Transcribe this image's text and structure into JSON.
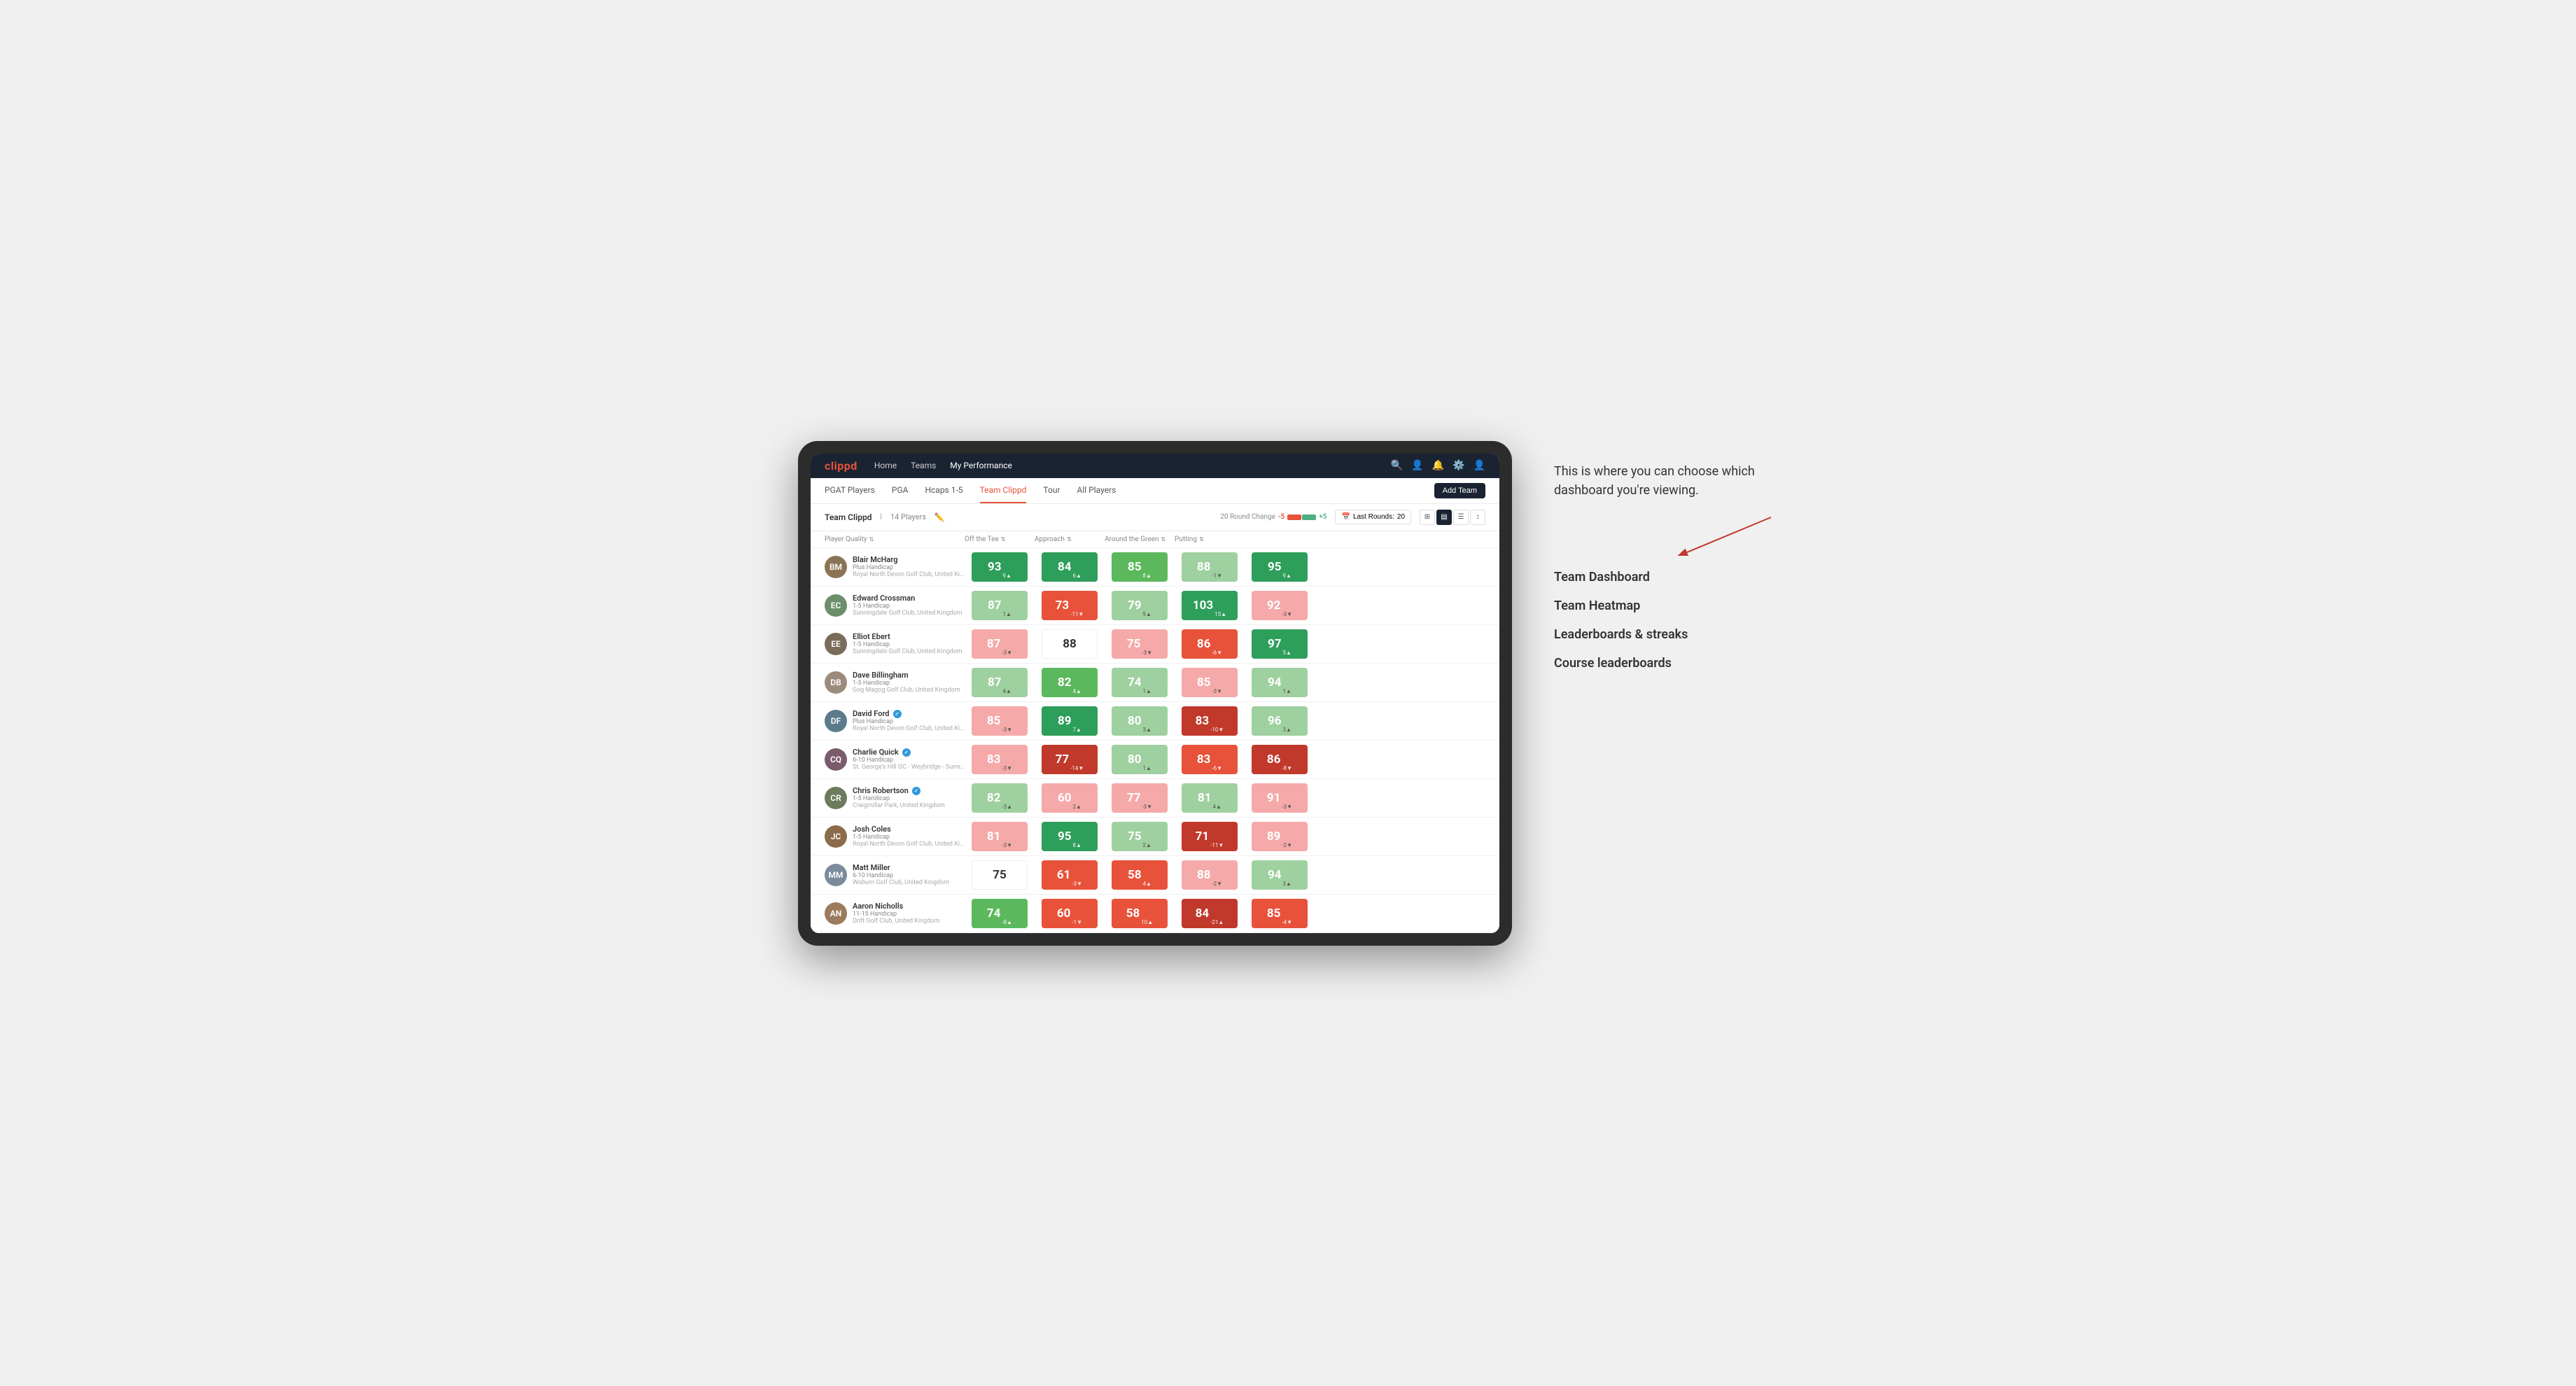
{
  "annotation": {
    "intro_text": "This is where you can choose which dashboard you're viewing.",
    "items": [
      {
        "id": "team-dashboard",
        "label": "Team Dashboard"
      },
      {
        "id": "team-heatmap",
        "label": "Team Heatmap"
      },
      {
        "id": "leaderboards",
        "label": "Leaderboards & streaks"
      },
      {
        "id": "course-leaderboards",
        "label": "Course leaderboards"
      }
    ]
  },
  "top_nav": {
    "logo": "clippd",
    "links": [
      {
        "label": "Home",
        "active": false
      },
      {
        "label": "Teams",
        "active": false
      },
      {
        "label": "My Performance",
        "active": true
      }
    ]
  },
  "sub_nav": {
    "links": [
      {
        "label": "PGAT Players",
        "active": false
      },
      {
        "label": "PGA",
        "active": false
      },
      {
        "label": "Hcaps 1-5",
        "active": false
      },
      {
        "label": "Team Clippd",
        "active": true
      },
      {
        "label": "Tour",
        "active": false
      },
      {
        "label": "All Players",
        "active": false
      }
    ],
    "add_team_label": "Add Team"
  },
  "team_header": {
    "team_name": "Team Clippd",
    "player_count": "14 Players",
    "round_change_label": "20 Round Change",
    "round_change_neg": "-5",
    "round_change_pos": "+5",
    "last_rounds_label": "Last Rounds:",
    "last_rounds_value": "20"
  },
  "table": {
    "columns": [
      {
        "label": "Player Quality",
        "id": "player-quality"
      },
      {
        "label": "Off the Tee",
        "id": "off-tee"
      },
      {
        "label": "Approach",
        "id": "approach"
      },
      {
        "label": "Around the Green",
        "id": "around-green"
      },
      {
        "label": "Putting",
        "id": "putting"
      }
    ],
    "players": [
      {
        "name": "Blair McHarg",
        "handicap": "Plus Handicap",
        "club": "Royal North Devon Golf Club, United Kingdom",
        "avatar_initials": "BM",
        "avatar_class": "avatar-1",
        "scores": [
          {
            "value": "93",
            "change": "9▲",
            "bg": "bg-green-dark"
          },
          {
            "value": "84",
            "change": "6▲",
            "bg": "bg-green-dark"
          },
          {
            "value": "85",
            "change": "8▲",
            "bg": "bg-green-mid"
          },
          {
            "value": "88",
            "change": "-1▼",
            "bg": "bg-green-light"
          },
          {
            "value": "95",
            "change": "9▲",
            "bg": "bg-green-dark"
          }
        ]
      },
      {
        "name": "Edward Crossman",
        "handicap": "1-5 Handicap",
        "club": "Sunningdale Golf Club, United Kingdom",
        "avatar_initials": "EC",
        "avatar_class": "avatar-2",
        "scores": [
          {
            "value": "87",
            "change": "1▲",
            "bg": "bg-green-light"
          },
          {
            "value": "73",
            "change": "-11▼",
            "bg": "bg-red-mid"
          },
          {
            "value": "79",
            "change": "9▲",
            "bg": "bg-green-light"
          },
          {
            "value": "103",
            "change": "15▲",
            "bg": "bg-green-dark"
          },
          {
            "value": "92",
            "change": "-3▼",
            "bg": "bg-red-light"
          }
        ]
      },
      {
        "name": "Elliot Ebert",
        "handicap": "1-5 Handicap",
        "club": "Sunningdale Golf Club, United Kingdom",
        "avatar_initials": "EE",
        "avatar_class": "avatar-3",
        "scores": [
          {
            "value": "87",
            "change": "-3▼",
            "bg": "bg-red-light"
          },
          {
            "value": "88",
            "change": "",
            "bg": "bg-white"
          },
          {
            "value": "75",
            "change": "-3▼",
            "bg": "bg-red-light"
          },
          {
            "value": "86",
            "change": "-6▼",
            "bg": "bg-red-mid"
          },
          {
            "value": "97",
            "change": "5▲",
            "bg": "bg-green-dark"
          }
        ]
      },
      {
        "name": "Dave Billingham",
        "handicap": "1-5 Handicap",
        "club": "Gog Magog Golf Club, United Kingdom",
        "avatar_initials": "DB",
        "avatar_class": "avatar-4",
        "scores": [
          {
            "value": "87",
            "change": "4▲",
            "bg": "bg-green-light"
          },
          {
            "value": "82",
            "change": "4▲",
            "bg": "bg-green-mid"
          },
          {
            "value": "74",
            "change": "1▲",
            "bg": "bg-green-light"
          },
          {
            "value": "85",
            "change": "-3▼",
            "bg": "bg-red-light"
          },
          {
            "value": "94",
            "change": "1▲",
            "bg": "bg-green-light"
          }
        ]
      },
      {
        "name": "David Ford",
        "handicap": "Plus Handicap",
        "club": "Royal North Devon Golf Club, United Kingdom",
        "avatar_initials": "DF",
        "avatar_class": "avatar-5",
        "badge": true,
        "scores": [
          {
            "value": "85",
            "change": "-3▼",
            "bg": "bg-red-light"
          },
          {
            "value": "89",
            "change": "7▲",
            "bg": "bg-green-dark"
          },
          {
            "value": "80",
            "change": "3▲",
            "bg": "bg-green-light"
          },
          {
            "value": "83",
            "change": "-10▼",
            "bg": "bg-red-dark"
          },
          {
            "value": "96",
            "change": "3▲",
            "bg": "bg-green-light"
          }
        ]
      },
      {
        "name": "Charlie Quick",
        "handicap": "6-10 Handicap",
        "club": "St. George's Hill GC - Weybridge - Surrey, Uni...",
        "avatar_initials": "CQ",
        "avatar_class": "avatar-6",
        "badge": true,
        "scores": [
          {
            "value": "83",
            "change": "-3▼",
            "bg": "bg-red-light"
          },
          {
            "value": "77",
            "change": "-14▼",
            "bg": "bg-red-dark"
          },
          {
            "value": "80",
            "change": "1▲",
            "bg": "bg-green-light"
          },
          {
            "value": "83",
            "change": "-6▼",
            "bg": "bg-red-mid"
          },
          {
            "value": "86",
            "change": "-8▼",
            "bg": "bg-red-dark"
          }
        ]
      },
      {
        "name": "Chris Robertson",
        "handicap": "1-5 Handicap",
        "club": "Craigmillar Park, United Kingdom",
        "avatar_initials": "CR",
        "avatar_class": "avatar-7",
        "badge": true,
        "scores": [
          {
            "value": "82",
            "change": "-3▲",
            "bg": "bg-green-light"
          },
          {
            "value": "60",
            "change": "2▲",
            "bg": "bg-red-light"
          },
          {
            "value": "77",
            "change": "-3▼",
            "bg": "bg-red-light"
          },
          {
            "value": "81",
            "change": "4▲",
            "bg": "bg-green-light"
          },
          {
            "value": "91",
            "change": "-3▼",
            "bg": "bg-red-light"
          }
        ]
      },
      {
        "name": "Josh Coles",
        "handicap": "1-5 Handicap",
        "club": "Royal North Devon Golf Club, United Kingdom",
        "avatar_initials": "JC",
        "avatar_class": "avatar-8",
        "scores": [
          {
            "value": "81",
            "change": "-3▼",
            "bg": "bg-red-light"
          },
          {
            "value": "95",
            "change": "8▲",
            "bg": "bg-green-dark"
          },
          {
            "value": "75",
            "change": "2▲",
            "bg": "bg-green-light"
          },
          {
            "value": "71",
            "change": "-11▼",
            "bg": "bg-red-dark"
          },
          {
            "value": "89",
            "change": "-2▼",
            "bg": "bg-red-light"
          }
        ]
      },
      {
        "name": "Matt Miller",
        "handicap": "6-10 Handicap",
        "club": "Woburn Golf Club, United Kingdom",
        "avatar_initials": "MM",
        "avatar_class": "avatar-9",
        "scores": [
          {
            "value": "75",
            "change": "",
            "bg": "bg-white"
          },
          {
            "value": "61",
            "change": "-3▼",
            "bg": "bg-red-mid"
          },
          {
            "value": "58",
            "change": "4▲",
            "bg": "bg-red-mid"
          },
          {
            "value": "88",
            "change": "-2▼",
            "bg": "bg-red-light"
          },
          {
            "value": "94",
            "change": "3▲",
            "bg": "bg-green-light"
          }
        ]
      },
      {
        "name": "Aaron Nicholls",
        "handicap": "11-15 Handicap",
        "club": "Drift Golf Club, United Kingdom",
        "avatar_initials": "AN",
        "avatar_class": "avatar-10",
        "scores": [
          {
            "value": "74",
            "change": "-8▲",
            "bg": "bg-green-mid"
          },
          {
            "value": "60",
            "change": "-1▼",
            "bg": "bg-red-mid"
          },
          {
            "value": "58",
            "change": "10▲",
            "bg": "bg-red-mid"
          },
          {
            "value": "84",
            "change": "-21▲",
            "bg": "bg-red-dark"
          },
          {
            "value": "85",
            "change": "-4▼",
            "bg": "bg-red-mid"
          }
        ]
      }
    ]
  }
}
